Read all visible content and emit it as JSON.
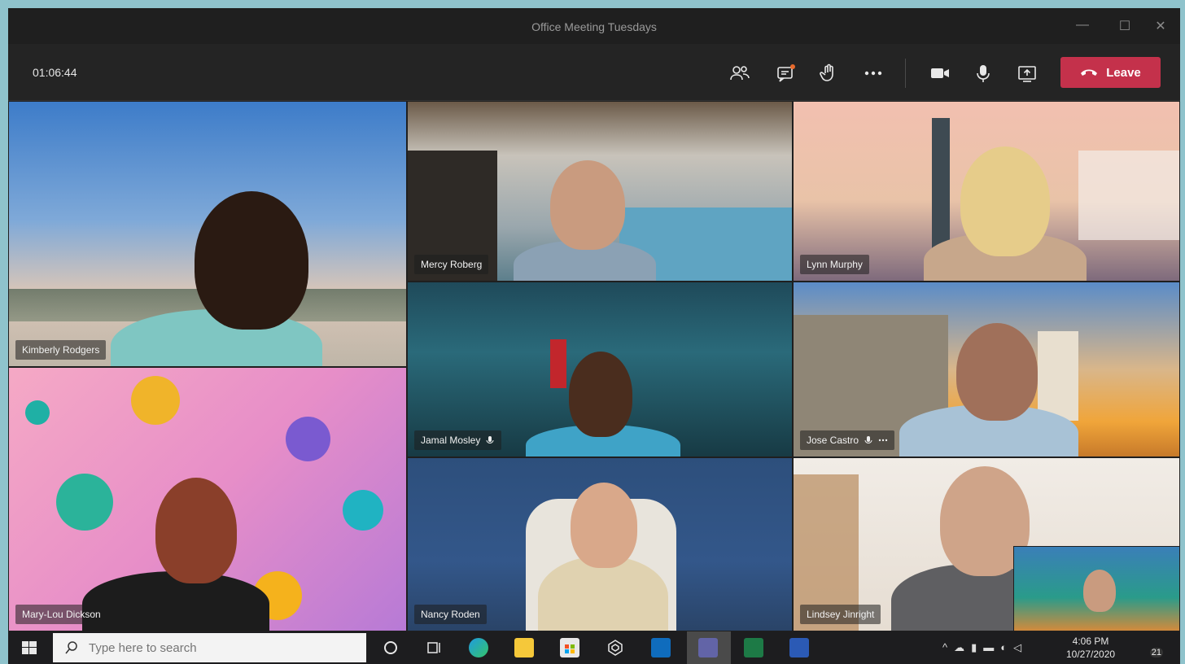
{
  "window": {
    "title": "Office Meeting Tuesdays",
    "minimize": "—",
    "maximize": "☐",
    "close": "✕"
  },
  "callbar": {
    "timer": "01:06:44",
    "icons": [
      "participants-icon",
      "chat-icon",
      "raise-hand-icon",
      "more-icon",
      "camera-icon",
      "microphone-icon",
      "share-screen-icon"
    ],
    "leave_label": "Leave",
    "leave_color": "#c4314b"
  },
  "participants": [
    {
      "name": "Kimberly Rodgers"
    },
    {
      "name": "Mercy Roberg"
    },
    {
      "name": "Lynn Murphy"
    },
    {
      "name": "Jamal Mosley"
    },
    {
      "name": "Jose Castro"
    },
    {
      "name": "Mary-Lou Dickson"
    },
    {
      "name": "Nancy Roden"
    },
    {
      "name": "Lindsey Jinright"
    }
  ],
  "taskbar": {
    "search_placeholder": "Type here to search",
    "apps": [
      "start-icon",
      "cortana-icon",
      "task-view-icon",
      "edge-icon",
      "file-explorer-icon",
      "store-icon",
      "dev-app-icon",
      "outlook-icon",
      "teams-icon",
      "excel-icon",
      "word-icon"
    ],
    "time": "4:06 PM",
    "date": "10/27/2020",
    "notification_count": "21"
  }
}
